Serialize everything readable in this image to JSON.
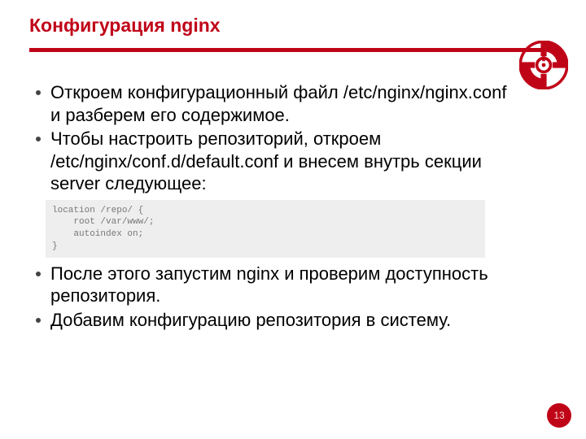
{
  "title": "Конфигурация nginx",
  "bullets": {
    "b1": "Откроем конфигурационный файл /etc/nginx/nginx.conf и разберем его содержимое.",
    "b2": "Чтобы настроить репозиторий, откроем /etc/nginx/conf.d/default.conf и внесем внутрь секции server следующее:",
    "b3": "После этого запустим nginx и проверим доступность репозитория.",
    "b4": "Добавим конфигурацию репозитория в систему."
  },
  "code": "location /repo/ {\n    root /var/www/;\n    autoindex on;\n}",
  "page_number": "13",
  "colors": {
    "brand": "#c00418"
  }
}
